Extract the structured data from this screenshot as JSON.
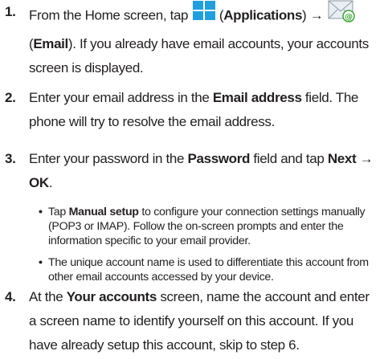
{
  "steps": [
    {
      "number": "1.",
      "pre": "From the Home screen, tap ",
      "apps_label": "Applications",
      "arrow": "→",
      "email_label": "Email",
      "post": ". If you already have email accounts, your accounts screen is displayed."
    },
    {
      "number": "2.",
      "pre": "Enter your email address in the ",
      "field": "Email address",
      "post": " field. The phone will try to resolve the email address."
    },
    {
      "number": "3.",
      "pre": "Enter your password in the ",
      "field": "Password",
      "mid": " field and tap ",
      "next": "Next",
      "arrow": "→",
      "ok": "OK",
      "post": "."
    },
    {
      "number": "4.",
      "pre": "At the ",
      "screen": "Your accounts",
      "post": " screen, name the account and enter a screen name to identify yourself on this account. If you have already setup this account, skip to step 6."
    }
  ],
  "bullets": [
    {
      "pre": "Tap ",
      "bold": "Manual setup",
      "post": " to configure your connection settings manually (POP3 or IMAP). Follow the on-screen prompts and enter the information specific to your email provider."
    },
    {
      "text": "The unique account name is used to differentiate this account from other email accounts accessed by your device."
    }
  ],
  "icons": {
    "applications": "applications-grid-icon",
    "email": "email-envelope-icon"
  },
  "colors": {
    "text": "#231f20",
    "apps_icon": "#1f9ee0",
    "email_icon_bg": "#e8eef2",
    "email_at": "#3aa335"
  }
}
